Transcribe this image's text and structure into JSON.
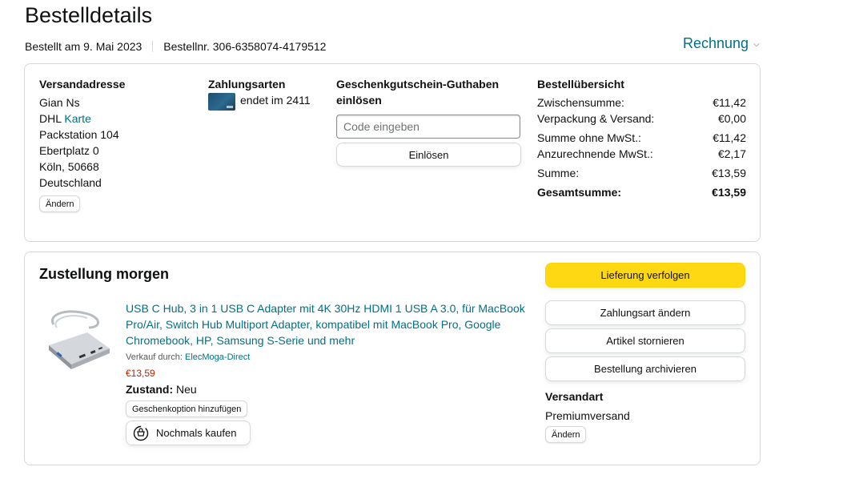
{
  "page": {
    "title": "Bestelldetails",
    "ordered_on": "Bestellt am 9. Mai 2023",
    "order_number": "Bestellnr. 306-6358074-4179512",
    "invoice_label": "Rechnung",
    "invoice_icon": "chevron-down-icon"
  },
  "summary": {
    "shipping_address": {
      "heading": "Versandadresse",
      "name": "Gian Ns",
      "carrier": "DHL",
      "map_link": "Karte",
      "line1": "Packstation 104",
      "line2": "Ebertplatz 0",
      "city": "Köln, 50668",
      "country": "Deutschland",
      "change_label": "Ändern"
    },
    "payment": {
      "heading": "Zahlungsarten",
      "card_ending": "endet im 2411",
      "card_icon": "credit-card-icon"
    },
    "gift_card": {
      "heading_line1": "Geschenkgutschein-Guthaben",
      "heading_line2": "einlösen",
      "placeholder": "Code eingeben",
      "redeem_label": "Einlösen"
    },
    "overview": {
      "heading": "Bestellübersicht",
      "rows": [
        {
          "label": "Zwischensumme:",
          "value": "€11,42"
        },
        {
          "label": "Verpackung & Versand:",
          "value": "€0,00"
        },
        {
          "label": "Summe ohne MwSt.:",
          "value": "€11,42"
        },
        {
          "label": "Anzurechnende MwSt.:",
          "value": "€2,17"
        },
        {
          "label": "Summe:",
          "value": "€13,59"
        },
        {
          "label": "Gesamtsumme:",
          "value": "€13,59"
        }
      ]
    }
  },
  "delivery": {
    "title": "Zustellung morgen",
    "product": {
      "title": "USB C Hub, 3 in 1 USB C Adapter mit 4K 30Hz HDMI 1 USB A 3.0, für MacBook Pro/Air, Switch Hub Multiport Adapter, kompatibel mit MacBook Pro, Google Chromebook, HP, Samsung S-Serie und mehr",
      "seller_label": "Verkauf durch:",
      "seller_name": "ElecMoga-Direct",
      "price": "€13,59",
      "condition_label": "Zustand:",
      "condition_value": "Neu",
      "gift_option_label": "Geschenkoption hinzufügen",
      "rebuy_label": "Nochmals kaufen",
      "rebuy_icon": "buy-again-icon",
      "image_icon": "usb-hub-product-image"
    },
    "actions": {
      "track": "Lieferung verfolgen",
      "change_payment": "Zahlungsart ändern",
      "cancel": "Artikel stornieren",
      "archive": "Bestellung archivieren"
    },
    "shipping_method": {
      "heading": "Versandart",
      "value": "Premiumversand",
      "change_label": "Ändern"
    }
  },
  "colors": {
    "link": "#007185",
    "price": "#b12704",
    "primary_button": "#ffd814",
    "border": "#d5d9d9",
    "text": "#0f1111"
  }
}
